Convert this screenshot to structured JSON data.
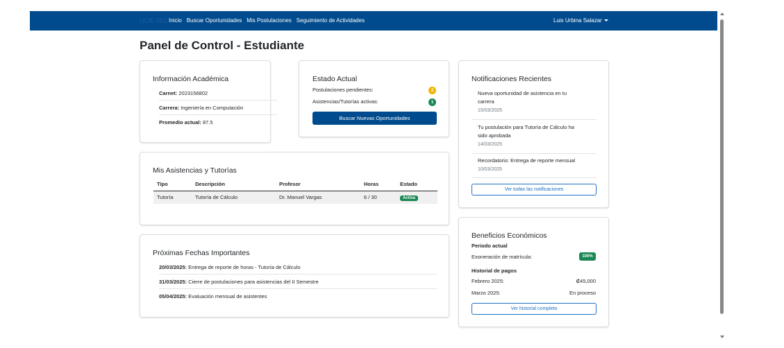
{
  "navbar": {
    "brand": "UCR-TEC",
    "links": [
      "Inicio",
      "Buscar Oportunidades",
      "Mis Postulaciones",
      "Seguimiento de Actividades"
    ],
    "user_name": "Luis Urbina Salazar",
    "bg_color": "#004b8d"
  },
  "page_title": "Panel de Control - Estudiante",
  "academic": {
    "title": "Información Académica",
    "rows": [
      {
        "label": "Carnet:",
        "value": "2023156802"
      },
      {
        "label": "Carrera:",
        "value": "Ingeniería en Computación"
      },
      {
        "label": "Promedio actual:",
        "value": "87.5"
      }
    ]
  },
  "status": {
    "title": "Estado Actual",
    "rows": [
      {
        "label": "Postulaciones pendientes:",
        "count": "2",
        "color": "#f0b400"
      },
      {
        "label": "Asistencias/Tutorías activas:",
        "count": "1",
        "color": "#198754"
      }
    ],
    "button_label": "Buscar Nuevas Oportunidades"
  },
  "assistances": {
    "title": "Mis Asistencias y Tutorías",
    "columns": [
      "Tipo",
      "Descripción",
      "Profesor",
      "Horas",
      "Estado"
    ],
    "rows": [
      {
        "tipo": "Tutoría",
        "descripcion": "Tutoría de Cálculo",
        "profesor": "Dr. Manuel Vargas",
        "horas": "6 / 30",
        "estado": "Activa"
      }
    ]
  },
  "dates": {
    "title": "Próximas Fechas Importantes",
    "items": [
      {
        "date": "20/03/2025:",
        "text": "Entrega de reporte de horas - Tutoría de Cálculo"
      },
      {
        "date": "31/03/2025:",
        "text": "Cierre de postulaciones para asistencias del II Semestre"
      },
      {
        "date": "05/04/2025:",
        "text": "Evaluación mensual de asistentes"
      }
    ]
  },
  "notifications": {
    "title": "Notificaciones Recientes",
    "items": [
      {
        "line1": "Nueva oportunidad de asistencia en tu",
        "line2": "carrera",
        "date": "15/03/2025"
      },
      {
        "line1": "Tu postulación para Tutoría de Cálculo ha",
        "line2": "sido aprobada",
        "date": "14/03/2025"
      },
      {
        "line1": "Recordatorio: Entrega de reporte mensual",
        "line2": "",
        "date": "10/03/2025"
      }
    ],
    "button_label": "Ver todas las notificaciones"
  },
  "benefits": {
    "title": "Beneficios Económicos",
    "period_label": "Periodo actual",
    "exoneration_label": "Exoneración de matrícula:",
    "exoneration_value": "100%",
    "history_label": "Historial de pagos",
    "payments": [
      {
        "month": "Febrero 2025:",
        "amount": "₡45,000"
      },
      {
        "month": "Marzo 2025:",
        "amount": "En proceso"
      }
    ],
    "button_label": "Ver historial completo"
  }
}
